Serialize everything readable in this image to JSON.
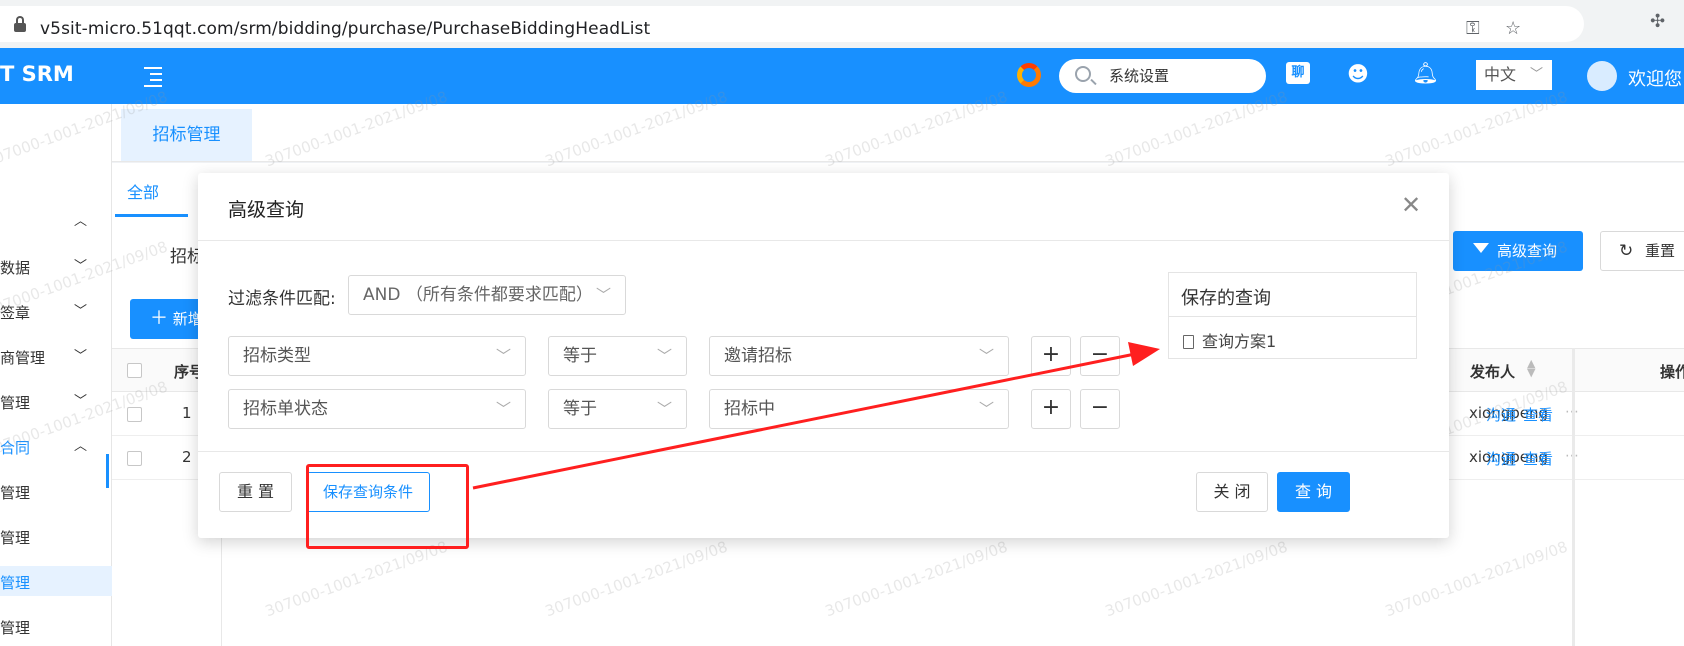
{
  "browser": {
    "url": "v5sit-micro.51qqt.com/srm/bidding/purchase/PurchaseBiddingHeadList"
  },
  "header": {
    "brand": "T SRM",
    "search_value": "系统设置",
    "chat_label": "聊",
    "language": "中文",
    "welcome": "欢迎您"
  },
  "sidebar": {
    "items": [
      {
        "label": "",
        "chevron": "up"
      },
      {
        "label": "数据",
        "chevron": "down"
      },
      {
        "label": "签章",
        "chevron": "down"
      },
      {
        "label": "商管理",
        "chevron": "down"
      },
      {
        "label": "管理",
        "chevron": "down"
      },
      {
        "label": "合同",
        "chevron": "up"
      },
      {
        "label": "管理",
        "chevron": ""
      },
      {
        "label": "管理",
        "chevron": ""
      },
      {
        "label": "管理",
        "chevron": ""
      },
      {
        "label": "管理",
        "chevron": ""
      }
    ]
  },
  "page": {
    "tab_label": "招标管理",
    "subtab_all": "全部",
    "filter_label": "招标",
    "advanced_query_button": "高级查询",
    "reset_button": "重置",
    "new_button": "新增",
    "table": {
      "columns": {
        "index": "序号",
        "publisher": "发布人",
        "actions": "操作"
      },
      "rows": [
        {
          "index": "1",
          "publisher": "xiongpeng",
          "actions": [
            "沟通",
            "查看"
          ]
        },
        {
          "index": "2",
          "publisher": "xiongpeng",
          "actions": [
            "沟通",
            "查看"
          ]
        }
      ]
    }
  },
  "watermark": "307000-1001-2021/09/08",
  "modal": {
    "title": "高级查询",
    "match_label": "过滤条件匹配:",
    "match_value": "AND （所有条件都要求匹配）",
    "conditions": [
      {
        "field": "招标类型",
        "operator": "等于",
        "value": "邀请招标"
      },
      {
        "field": "招标单状态",
        "operator": "等于",
        "value": "招标中"
      }
    ],
    "saved": {
      "title": "保存的查询",
      "items": [
        "查询方案1"
      ]
    },
    "footer": {
      "reset": "重 置",
      "save": "保存查询条件",
      "close": "关 闭",
      "query": "查 询"
    }
  },
  "colors": {
    "primary": "#1890ff",
    "annotation_red": "#ff1f1f"
  }
}
